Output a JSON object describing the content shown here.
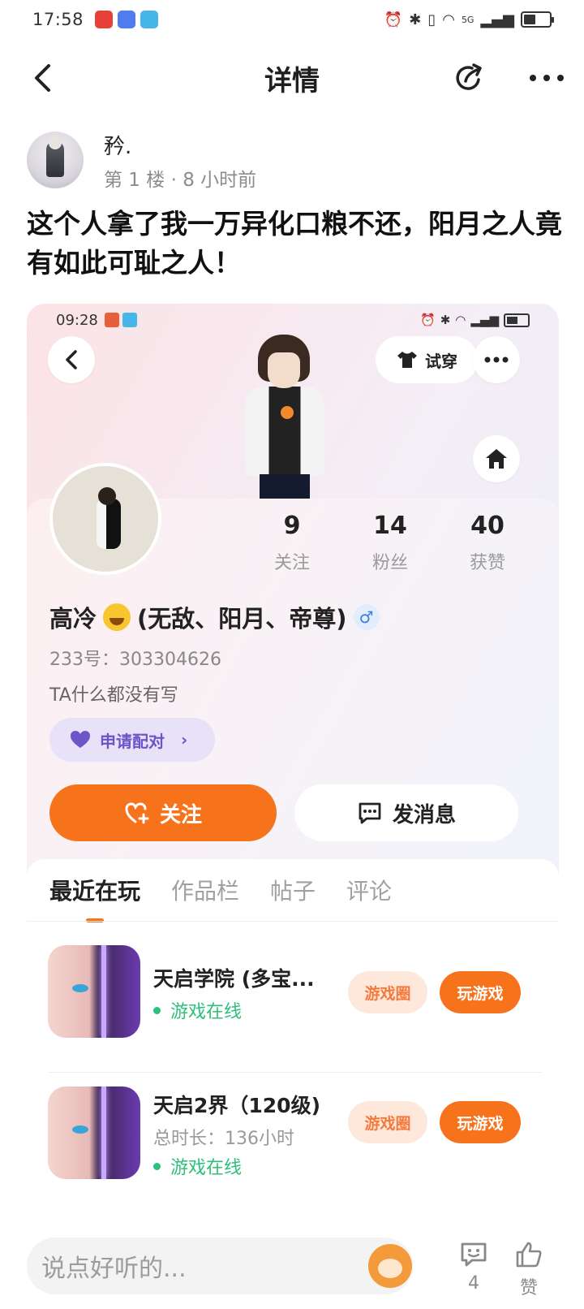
{
  "status_bar": {
    "time": "17:58",
    "signal": "5G"
  },
  "nav": {
    "title": "详情"
  },
  "post": {
    "author": "矜.",
    "meta": "第 1 楼 · 8 小时前",
    "text": "这个人拿了我一万异化口粮不还，阳月之人竟有如此可耻之人！"
  },
  "screenshot": {
    "status_time": "09:28",
    "try_on_label": "试穿",
    "stats": [
      {
        "value": "9",
        "label": "关注"
      },
      {
        "value": "14",
        "label": "粉丝"
      },
      {
        "value": "40",
        "label": "获赞"
      }
    ],
    "nickname_prefix": "高冷",
    "nickname_suffix": "(无敌、阳月、帝尊)",
    "gender_symbol": "♂",
    "uid": "233号：303304626",
    "bio": "TA什么都没有写",
    "pair_label": "申请配对",
    "follow_label": "关注",
    "message_label": "发消息",
    "tabs": [
      "最近在玩",
      "作品栏",
      "帖子",
      "评论"
    ],
    "games": [
      {
        "title": "天启学院 (多宝...",
        "subtitle": "",
        "status": "游戏在线",
        "circle_label": "游戏圈",
        "play_label": "玩游戏"
      },
      {
        "title": "天启2界（120级)",
        "subtitle": "总时长：136小时",
        "status": "游戏在线",
        "circle_label": "游戏圈",
        "play_label": "玩游戏"
      }
    ]
  },
  "bottom": {
    "placeholder": "说点好听的...",
    "comment_count": "4",
    "like_label": "赞"
  },
  "colors": {
    "accent": "#f6731c",
    "online": "#2dbf7b",
    "pair": "#6b55c8"
  }
}
